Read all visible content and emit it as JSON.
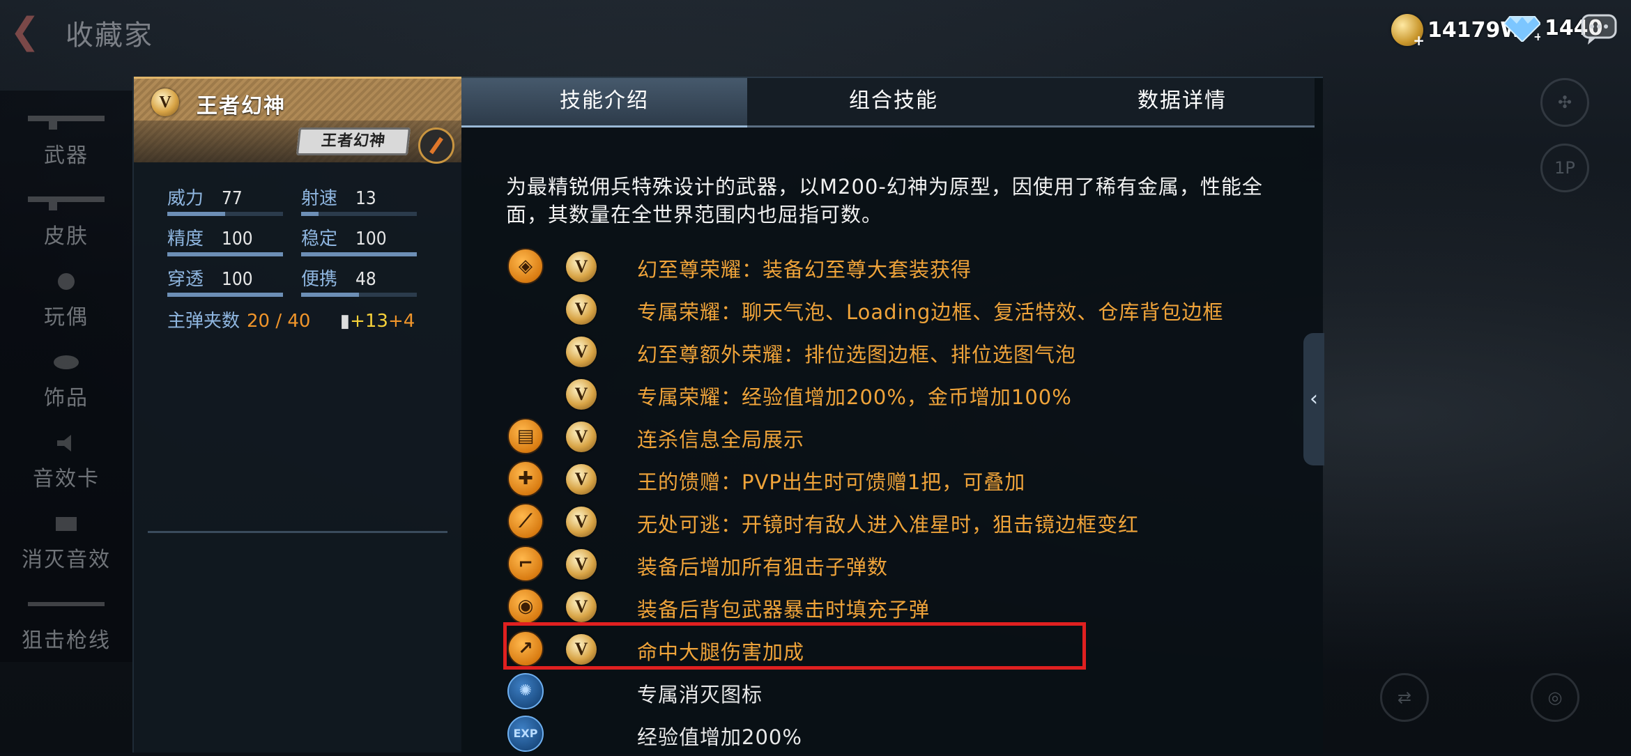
{
  "topbar": {
    "title": "收藏家",
    "gold": "14179W",
    "diamond": "1440"
  },
  "leftnav": {
    "items": [
      {
        "label": "武器"
      },
      {
        "label": "皮肤"
      },
      {
        "label": "玩偶"
      },
      {
        "label": "饰品"
      },
      {
        "label": "音效卡"
      },
      {
        "label": "消灭音效"
      },
      {
        "label": "狙击枪线"
      }
    ]
  },
  "weapon": {
    "name": "王者幻神",
    "logo_text": "王者幻神",
    "stats": {
      "power_label": "威力",
      "power": "77",
      "power_level": 0.5,
      "rate_label": "射速",
      "rate": "13",
      "rate_level": 0.15,
      "accuracy_label": "精度",
      "accuracy": "100",
      "accuracy_level": 1.0,
      "stability_label": "稳定",
      "stability": "100",
      "stability_level": 1.0,
      "pierce_label": "穿透",
      "pierce": "100",
      "pierce_level": 1.0,
      "mobility_label": "便携",
      "mobility": "48",
      "mobility_level": 0.5
    },
    "ammo": {
      "label": "主弹夹数",
      "count": "20 / 40",
      "bonus1": "+13",
      "bonus2": "+4"
    }
  },
  "tabs": [
    {
      "label": "技能介绍",
      "active": true
    },
    {
      "label": "组合技能",
      "active": false
    },
    {
      "label": "数据详情",
      "active": false
    }
  ],
  "description": "为最精锐佣兵特殊设计的武器，以M200-幻神为原型，因使用了稀有金属，性能全面，其数量在全世界范围内也屈指可数。",
  "skills": [
    {
      "icon": "diamond-emblem-icon",
      "text": "幻至尊荣耀：装备幻至尊大套装获得"
    },
    {
      "icon": "",
      "text": "专属荣耀：聊天气泡、Loading边框、复活特效、仓库背包边框"
    },
    {
      "icon": "",
      "text": "幻至尊额外荣耀：排位选图边框、排位选图气泡"
    },
    {
      "icon": "",
      "text": "专属荣耀：经验值增加200%，金币增加100%"
    },
    {
      "icon": "killfeed-icon",
      "text": "连杀信息全局展示"
    },
    {
      "icon": "gift-icon",
      "text": "王的馈赠：PVP出生时可馈赠1把，可叠加"
    },
    {
      "icon": "scope-icon",
      "text": "无处可逃：开镜时有敌人进入准星时，狙击镜边框变红"
    },
    {
      "icon": "pistol-icon",
      "text": "装备后增加所有狙击子弹数"
    },
    {
      "icon": "bullet-refill-icon",
      "text": "装备后背包武器暴击时填充子弹"
    },
    {
      "icon": "leg-hit-icon",
      "text": "命中大腿伤害加成"
    },
    {
      "icon": "kill-mark-icon",
      "text": "专属消灭图标"
    },
    {
      "icon": "exp-icon",
      "text": "经验值增加200%"
    }
  ],
  "colors": {
    "skill_text": "#f0a43a",
    "highlight_border": "#e02020",
    "accent_gold": "#d8a446"
  }
}
